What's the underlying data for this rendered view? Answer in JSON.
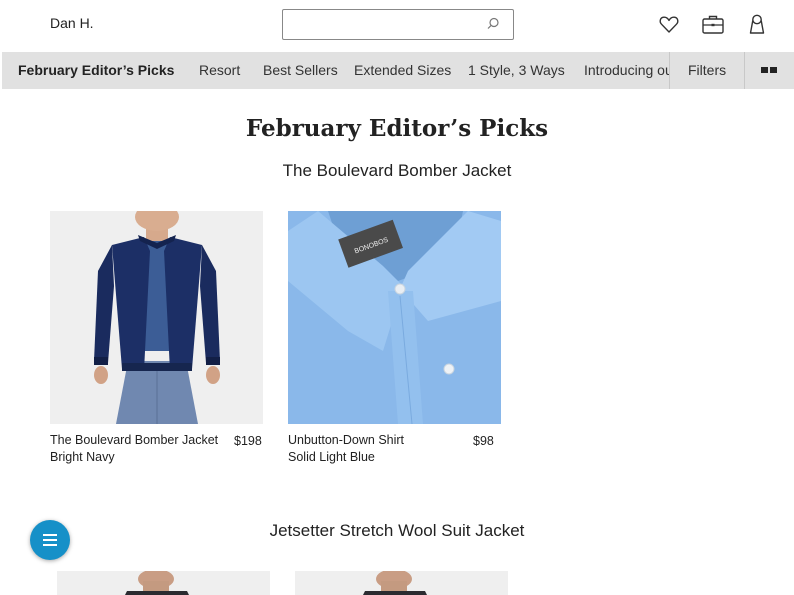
{
  "header": {
    "user_name": "Dan H.",
    "search": {
      "value": "",
      "placeholder": ""
    },
    "icons": [
      "search-icon",
      "heart-icon",
      "bag-icon",
      "account-icon"
    ]
  },
  "nav": {
    "items": [
      "February Editor’s Picks",
      "Resort",
      "Best Sellers",
      "Extended Sizes",
      "1 Style, 3 Ways",
      "Introducing our"
    ],
    "active_index": 0,
    "filters_label": "Filters",
    "grid_toggle_icon": "grid-view-icon",
    "background_color": "#e1e1e1"
  },
  "page": {
    "title": "February Editor’s Picks"
  },
  "sections": [
    {
      "title": "The Boulevard Bomber Jacket",
      "products": [
        {
          "name": "The Boulevard Bomber Jacket",
          "color": "Bright Navy",
          "price": "$198",
          "image": "navy-bomber-jacket-model"
        },
        {
          "name": "Unbutton-Down Shirt",
          "color": "Solid Light Blue",
          "price": "$98",
          "image": "light-blue-shirt-closeup",
          "label_text": "BONOBOS"
        }
      ]
    },
    {
      "title": "Jetsetter Stretch Wool Suit Jacket",
      "products": [
        {
          "image": "suit-jacket-model"
        },
        {
          "image": "suit-jacket-model"
        }
      ]
    }
  ],
  "fab": {
    "icon": "menu-icon",
    "color": "#1690c8"
  }
}
